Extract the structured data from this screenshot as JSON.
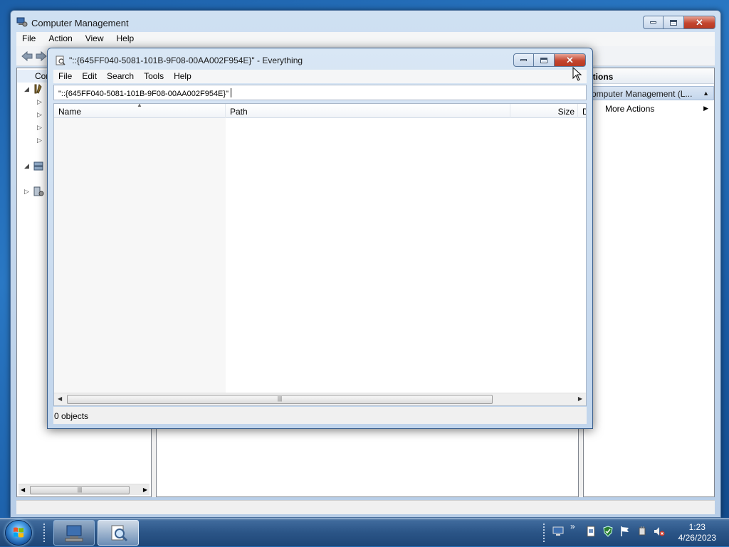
{
  "computer_management": {
    "title": "Computer Management",
    "menu": [
      "File",
      "Action",
      "View",
      "Help"
    ],
    "tree_root_label": "Com",
    "actions_header": "ctions",
    "actions_section": "omputer Management (L...",
    "more_actions": "More Actions"
  },
  "everything": {
    "title": "\"::{645FF040-5081-101B-9F08-00AA002F954E}\"  - Everything",
    "menu": [
      "File",
      "Edit",
      "Search",
      "Tools",
      "Help"
    ],
    "search_value": "\"::{645FF040-5081-101B-9F08-00AA002F954E}\"",
    "columns": {
      "name": "Name",
      "path": "Path",
      "size": "Size",
      "date": "D"
    },
    "status": "0 objects"
  },
  "taskbar": {
    "time": "1:23",
    "date": "4/26/2023"
  },
  "colors": {
    "desktop": "#1c5fa8",
    "close_button": "#c4452f",
    "taskbar": "#2b5587"
  },
  "icons": [
    "computer-management-icon",
    "everything-icon",
    "start-orb",
    "network-icon",
    "flag-icon",
    "volume-muted-icon"
  ]
}
